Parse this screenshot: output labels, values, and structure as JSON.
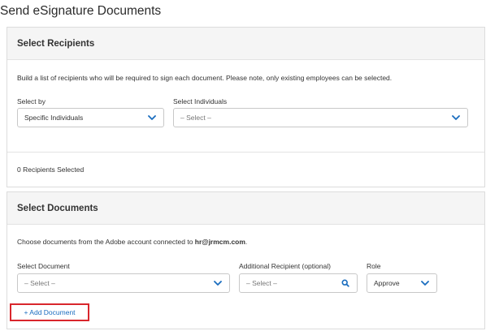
{
  "page": {
    "title": "Send eSignature Documents"
  },
  "recipients": {
    "title": "Select Recipients",
    "help": "Build a list of recipients who will be required to sign each document. Please note, only existing employees can be selected.",
    "select_by_label": "Select by",
    "select_by_value": "Specific Individuals",
    "individuals_label": "Select Individuals",
    "individuals_placeholder": "– Select –",
    "count_text": "0 Recipients Selected"
  },
  "documents": {
    "title": "Select Documents",
    "help_prefix": "Choose documents from the Adobe account connected to ",
    "help_email": "hr@jrmcm.com",
    "help_suffix": ".",
    "document_label": "Select Document",
    "document_placeholder": "– Select –",
    "additional_label": "Additional Recipient (optional)",
    "additional_placeholder": "– Select –",
    "role_label": "Role",
    "role_value": "Approve",
    "add_document_label": "+ Add Document"
  },
  "colors": {
    "accent": "#1a6dbf",
    "highlight": "#d9262c",
    "panel_header_bg": "#f5f5f5"
  },
  "icons": {
    "dropdown": "chevron-down-icon",
    "search": "search-icon"
  }
}
